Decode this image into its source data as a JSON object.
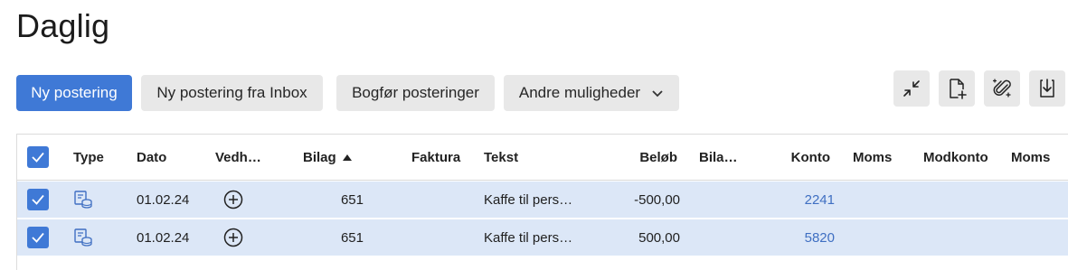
{
  "page": {
    "title": "Daglig"
  },
  "toolbar": {
    "new_entry": "Ny postering",
    "new_from_inbox": "Ny postering fra Inbox",
    "post_entries": "Bogfør posteringer",
    "more_options": "Andre muligheder"
  },
  "icons": {
    "collapse": "collapse-icon",
    "new_doc": "new-document-icon",
    "attach_magic": "magic-attach-icon",
    "download": "download-icon"
  },
  "colors": {
    "accent": "#3f79d6",
    "row_selected": "#dce7f7",
    "link": "#3f6fc2"
  },
  "table": {
    "columns": {
      "type": "Type",
      "date": "Dato",
      "attachment": "Vedh…",
      "voucher": "Bilag",
      "invoice": "Faktura",
      "text": "Tekst",
      "amount": "Beløb",
      "voucher2": "Bila…",
      "account": "Konto",
      "vat": "Moms",
      "counter_account": "Modkonto",
      "vat2": "Moms"
    },
    "rows": [
      {
        "date": "01.02.24",
        "voucher": "651",
        "text": "Kaffe til pers…",
        "amount": "-500,00",
        "account": "2241",
        "selected": true
      },
      {
        "date": "01.02.24",
        "voucher": "651",
        "text": "Kaffe til pers…",
        "amount": "500,00",
        "account": "5820",
        "selected": true
      }
    ]
  }
}
